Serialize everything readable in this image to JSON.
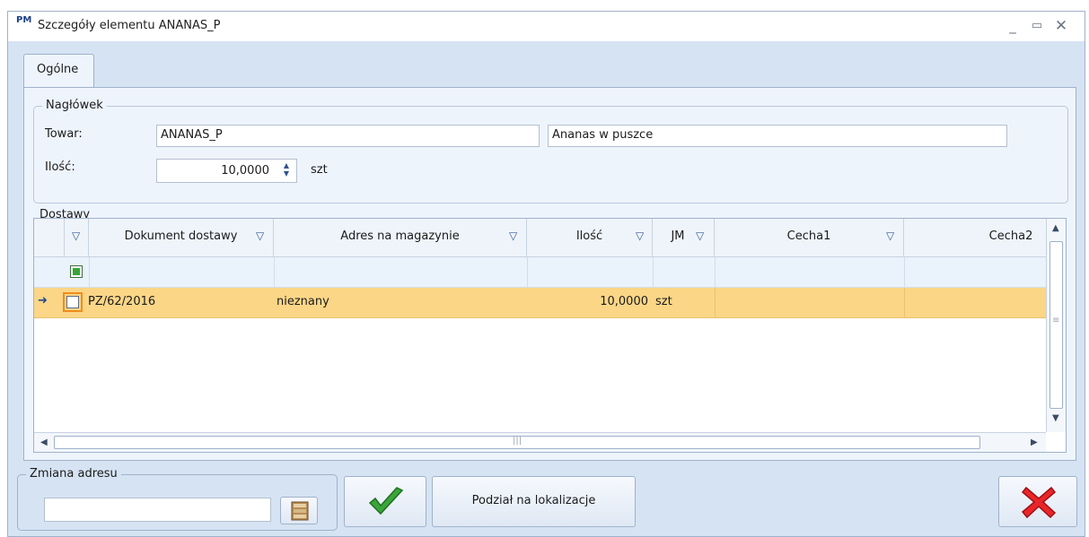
{
  "window": {
    "icon_text": "PM",
    "title": "Szczegóły elementu ANANAS_P",
    "controls": {
      "minimize": "_",
      "maximize": "▭",
      "close": "✕"
    }
  },
  "tabs": [
    {
      "label": "Ogólne",
      "active": true
    }
  ],
  "header_group": {
    "title": "Nagłówek",
    "towar_label": "Towar:",
    "towar_code": "ANANAS_P",
    "towar_name": "Ananas w puszce",
    "ilosc_label": "Ilość:",
    "ilosc_value": "10,0000",
    "ilosc_unit": "szt"
  },
  "deliveries_group": {
    "title": "Dostawy",
    "columns": [
      "",
      "Dokument dostawy",
      "Adres na magazynie",
      "Ilość",
      "JM",
      "Cecha1",
      "Cecha2"
    ],
    "rows": [
      {
        "dokument": "PZ/62/2016",
        "adres": "nieznany",
        "ilosc": "10,0000",
        "jm": "szt",
        "cecha1": "",
        "cecha2": "",
        "checked": false,
        "current": true
      }
    ]
  },
  "address_group": {
    "title": "Zmiana adresu",
    "value": ""
  },
  "buttons": {
    "split_label": "Podział na lokalizacje"
  },
  "icons": [
    "shelf-icon",
    "checkmark-icon",
    "cancel-x-icon",
    "filter-icon",
    "row-indicator-icon"
  ],
  "colors": {
    "selected_row": "#fbd687",
    "accent": "#f08c1e",
    "ok_green": "#3aa63a",
    "cancel_red": "#e8262a"
  }
}
